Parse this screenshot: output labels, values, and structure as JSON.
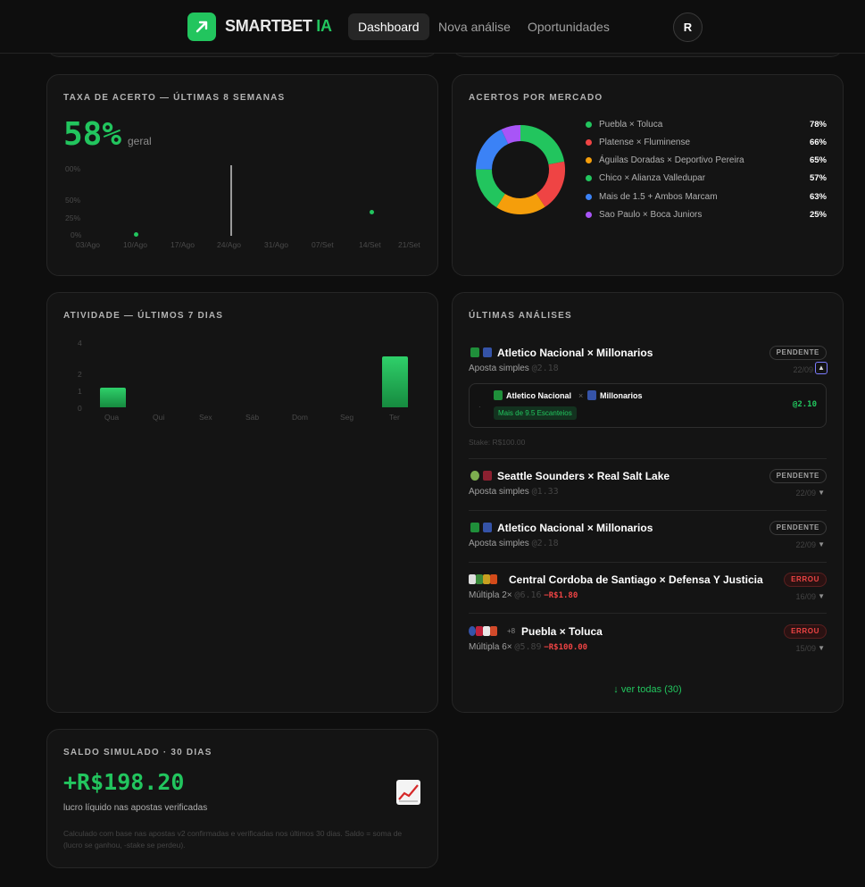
{
  "brand": {
    "name": "SMARTBET",
    "suffix": "IA",
    "icon": "arrow-up-right-icon",
    "accent": "#22c55e"
  },
  "nav": {
    "items": [
      {
        "label": "Dashboard",
        "active": true
      },
      {
        "label": "Nova análise",
        "active": false
      },
      {
        "label": "Oportunidades",
        "active": false
      }
    ]
  },
  "user": {
    "initial": "R"
  },
  "hit_rate": {
    "title": "TAXA DE ACERTO — ÚLTIMAS 8 SEMANAS",
    "value": "58%",
    "suffix": "geral",
    "y_ticks": [
      "00%",
      "50%",
      "25%",
      "0%"
    ],
    "x_ticks": [
      "03/Ago",
      "10/Ago",
      "17/Ago",
      "24/Ago",
      "31/Ago",
      "07/Set",
      "14/Set",
      "21/Set"
    ]
  },
  "markets": {
    "title": "ACERTOS POR MERCADO",
    "items": [
      {
        "label": "Puebla × Toluca",
        "pct": "78%",
        "color": "#22c55e"
      },
      {
        "label": "Platense × Fluminense",
        "pct": "66%",
        "color": "#ef4444"
      },
      {
        "label": "Águilas Doradas × Deportivo Pereira",
        "pct": "65%",
        "color": "#f59e0b"
      },
      {
        "label": "Chico × Alianza Valledupar",
        "pct": "57%",
        "color": "#22c55e"
      },
      {
        "label": "Mais de 1.5 + Ambos Marcam",
        "pct": "63%",
        "color": "#3b82f6"
      },
      {
        "label": "Sao Paulo × Boca Juniors",
        "pct": "25%",
        "color": "#a855f7"
      }
    ]
  },
  "activity": {
    "title": "ATIVIDADE — ÚLTIMOS 7 DIAS",
    "y_ticks": [
      "4",
      "2",
      "1",
      "0"
    ],
    "days": [
      "Qua",
      "Qui",
      "Sex",
      "Sáb",
      "Dom",
      "Seg",
      "Ter"
    ]
  },
  "chart_data": [
    {
      "type": "line",
      "title": "TAXA DE ACERTO — ÚLTIMAS 8 SEMANAS",
      "categories": [
        "03/Ago",
        "10/Ago",
        "17/Ago",
        "24/Ago",
        "31/Ago",
        "07/Set",
        "14/Set",
        "21/Set"
      ],
      "series": [
        {
          "values": [
            null,
            0,
            null,
            null,
            null,
            null,
            35,
            null
          ]
        }
      ],
      "ylim": [
        0,
        100
      ]
    },
    {
      "type": "pie",
      "title": "ACERTOS POR MERCADO",
      "categories": [
        "Puebla × Toluca",
        "Platense × Fluminense",
        "Águilas Doradas × Deportivo Pereira",
        "Chico × Alianza Valledupar",
        "Mais de 1.5 + Ambos Marcam",
        "Sao Paulo × Boca Juniors"
      ],
      "values": [
        78,
        66,
        65,
        57,
        63,
        25
      ]
    },
    {
      "type": "bar",
      "title": "ATIVIDADE — ÚLTIMOS 7 DIAS",
      "categories": [
        "Qua",
        "Qui",
        "Sex",
        "Sáb",
        "Dom",
        "Seg",
        "Ter"
      ],
      "values": [
        1,
        0,
        0,
        0,
        0,
        0,
        3
      ],
      "ylim": [
        0,
        4
      ]
    }
  ],
  "analyses": {
    "title": "ÚLTIMAS ANÁLISES",
    "expanded": {
      "home": "Atletico Nacional",
      "away": "Millonarios",
      "market": "Mais de 9.5 Escanteios",
      "odd": "@2.10",
      "stake": "Stake: R$100.00"
    },
    "items": [
      {
        "title": "Atletico Nacional × Millonarios",
        "type": "Aposta simples",
        "odd": "@2.18",
        "loss": "",
        "status": "PENDENTE",
        "date": "22/09",
        "extra": ""
      },
      {
        "title": "Seattle Sounders × Real Salt Lake",
        "type": "Aposta simples",
        "odd": "@1.33",
        "loss": "",
        "status": "PENDENTE",
        "date": "22/09",
        "extra": ""
      },
      {
        "title": "Atletico Nacional × Millonarios",
        "type": "Aposta simples",
        "odd": "@2.18",
        "loss": "",
        "status": "PENDENTE",
        "date": "22/09",
        "extra": ""
      },
      {
        "title": "Central Cordoba de Santiago × Defensa Y Justicia",
        "type": "Múltipla 2×",
        "odd": "@6.16",
        "loss": "−R$1.80",
        "status": "ERROU",
        "date": "16/09",
        "extra": ""
      },
      {
        "title": "Puebla × Toluca",
        "type": "Múltipla 6×",
        "odd": "@5.89",
        "loss": "−R$100.00",
        "status": "ERROU",
        "date": "15/09",
        "extra": "+8"
      }
    ],
    "see_all": "↓ ver todas (30)"
  },
  "balance": {
    "title": "SALDO SIMULADO · 30 DIAS",
    "value": "+R$198.20",
    "subtitle": "lucro líquido nas apostas verificadas",
    "note": "Calculado com base nas apostas v2 confirmadas e verificadas nos últimos 30 dias. Saldo = soma de (lucro se ganhou, -stake se perdeu).",
    "icon": "chart-increasing-icon"
  }
}
